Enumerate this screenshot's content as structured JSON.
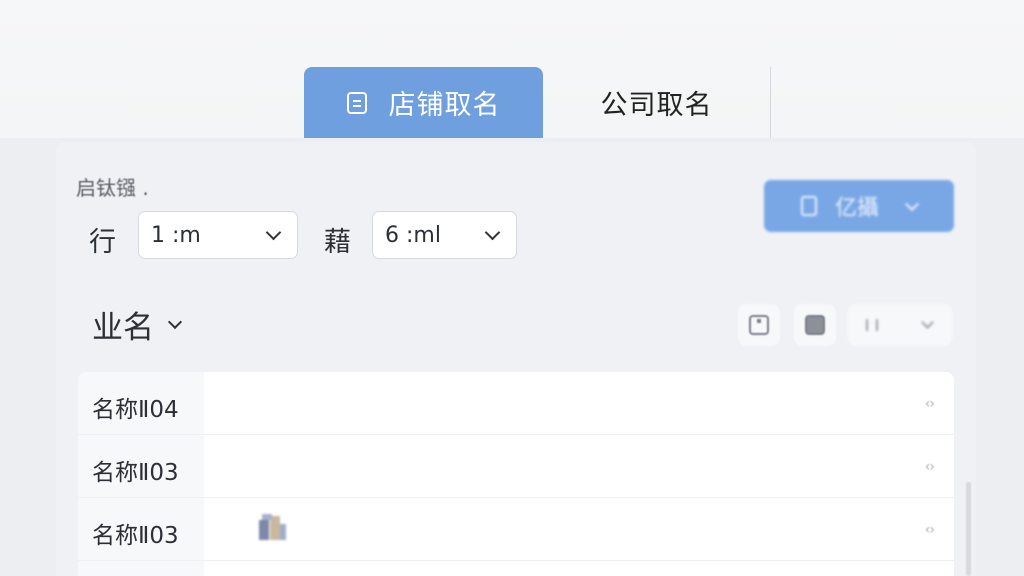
{
  "tabs": [
    {
      "label": "店铺取名",
      "active": true
    },
    {
      "label": "公司取名",
      "active": false
    }
  ],
  "panel": {
    "title": "启钛镪 .",
    "field1": {
      "label": "行",
      "value": "1 :m"
    },
    "field2": {
      "label": "藉",
      "value": "6 :ml"
    },
    "primary_button": {
      "label": "亿攝"
    },
    "section": {
      "label": "业名"
    },
    "toolbar_wide_label": "Ⅲ"
  },
  "list": {
    "rows": [
      {
        "name": "名称Ⅱ04",
        "more": "‹›"
      },
      {
        "name": "名称Ⅱ03",
        "more": "‹›"
      },
      {
        "name": "名称Ⅱ03",
        "more": "‹›"
      }
    ]
  },
  "colors": {
    "accent": "#6f9fdf",
    "button": "#79a7e6",
    "panel_bg": "#eff1f4",
    "list_bg": "#ffffff"
  },
  "icons": {
    "tab_icon": "document-icon",
    "primary_button_icon": "document-icon",
    "toolbar_icons": [
      "square-icon",
      "image-icon",
      "list-icon"
    ],
    "row_thumbnail": "shop-icon"
  }
}
